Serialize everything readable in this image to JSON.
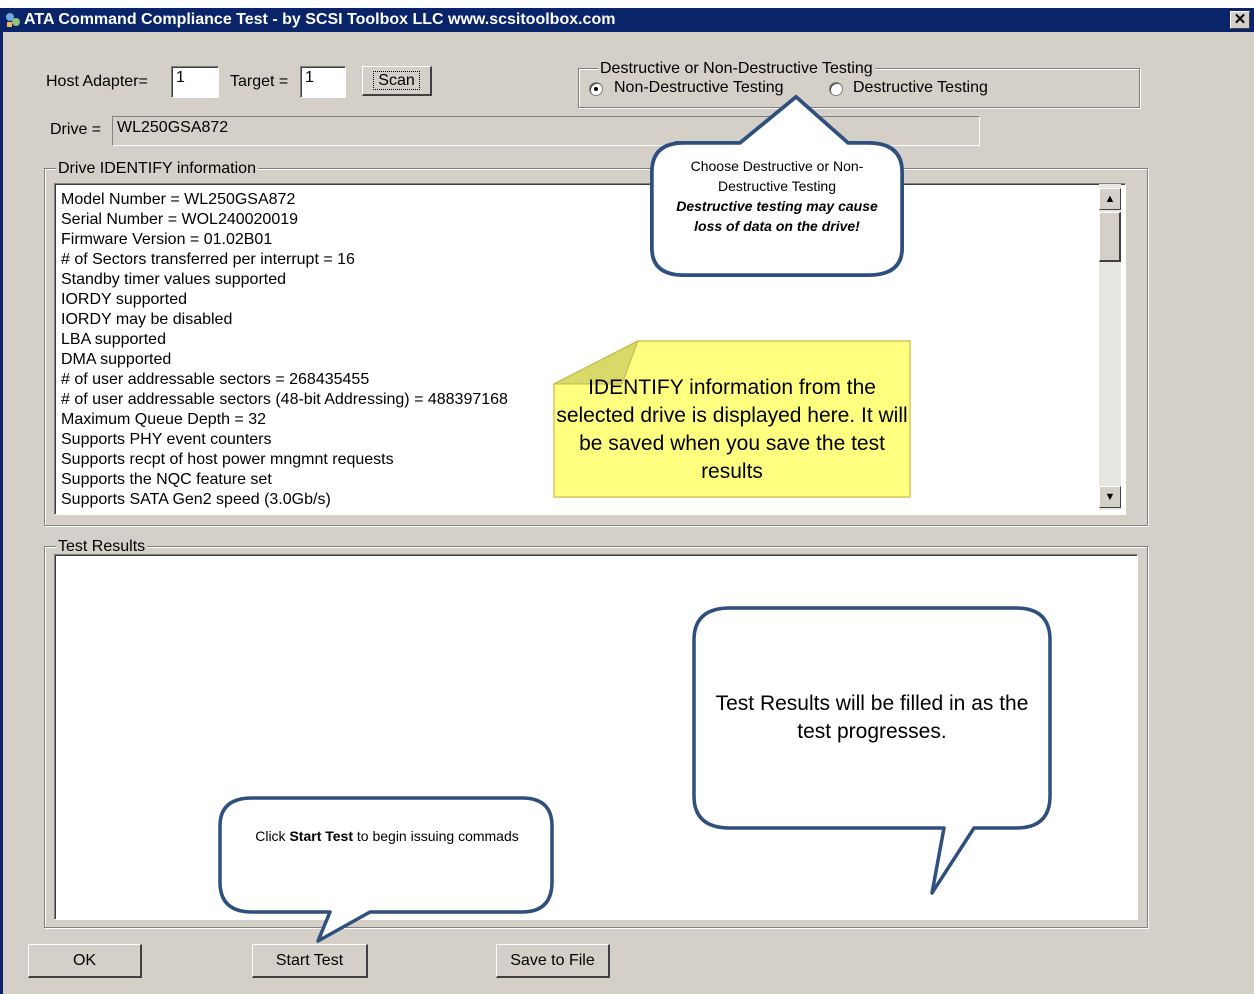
{
  "window": {
    "title": "ATA Command Compliance Test - by SCSI Toolbox LLC www.scsitoolbox.com",
    "close_glyph": "✕",
    "title_bar_color": "#0a246a"
  },
  "scan": {
    "host_adapter_label": "Host Adapter=",
    "host_adapter_value": "1",
    "target_label": "Target =",
    "target_value": "1",
    "scan_button": "Scan"
  },
  "test_mode": {
    "group_label": "Destructive or Non-Destructive Testing",
    "options": [
      {
        "label": "Non-Destructive Testing",
        "selected": true
      },
      {
        "label": "Destructive Testing",
        "selected": false
      }
    ]
  },
  "drive": {
    "label": "Drive =",
    "value": "WL250GSA872"
  },
  "identify": {
    "group_label": "Drive IDENTIFY information",
    "lines": [
      "Model Number = WL250GSA872",
      "Serial Number = WOL240020019",
      "Firmware Version = 01.02B01",
      "# of Sectors transferred per interrupt = 16",
      "Standby timer values supported",
      "IORDY supported",
      "IORDY may be disabled",
      "LBA supported",
      "DMA supported",
      "# of user addressable sectors = 268435455",
      "# of user addressable sectors (48-bit Addressing) = 488397168",
      "Maximum Queue Depth = 32",
      "Supports PHY event counters",
      "Supports recpt of host power mngmnt requests",
      "Supports the NQC feature set",
      "Supports SATA Gen2 speed (3.0Gb/s)"
    ]
  },
  "results": {
    "group_label": "Test Results"
  },
  "buttons": {
    "ok": "OK",
    "start_test": "Start Test",
    "save_to_file": "Save to File"
  },
  "callouts": {
    "destructive": {
      "line1": "Choose Destructive or Non-",
      "line2": "Destructive Testing",
      "warning": "Destructive testing may cause loss of data on the drive!"
    },
    "identify_note": "IDENTIFY information from the selected drive is displayed here. It will be saved when you save the test results",
    "results_note": "Test Results will be filled in as the test progresses.",
    "start_note_prefix": "Click ",
    "start_note_bold": "Start Test",
    "start_note_suffix": " to begin issuing commads"
  }
}
